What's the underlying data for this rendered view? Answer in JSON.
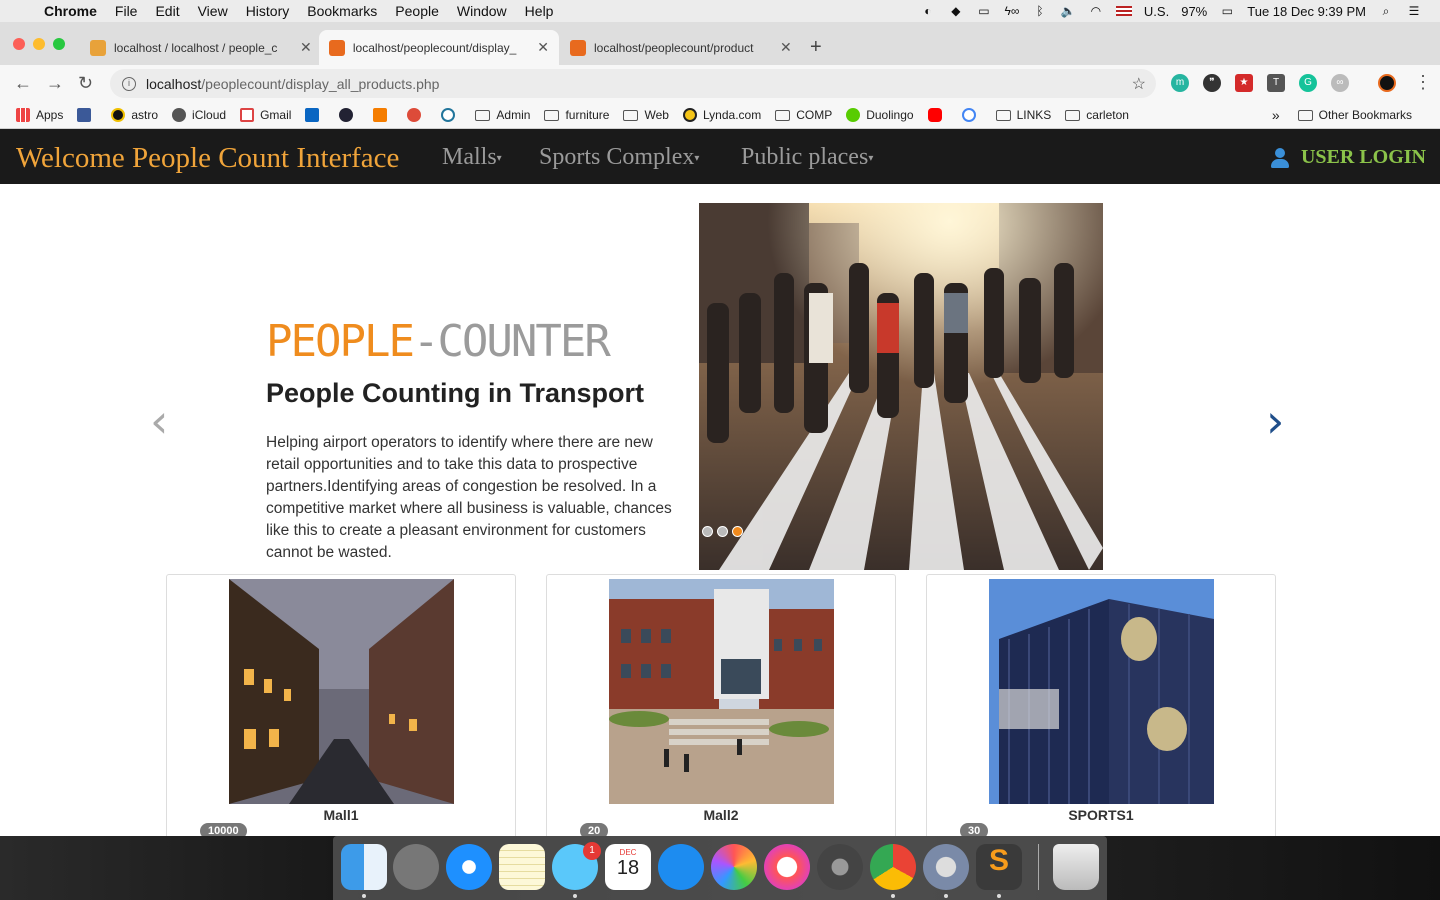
{
  "menubar": {
    "app": "Chrome",
    "items": [
      "File",
      "Edit",
      "View",
      "History",
      "Bookmarks",
      "People",
      "Window",
      "Help"
    ],
    "input_source": "U.S.",
    "battery": "97%",
    "datetime": "Tue 18 Dec  9:39 PM"
  },
  "tabs": [
    {
      "label": "localhost / localhost / people_c",
      "favicon_color": "#e8a23a"
    },
    {
      "label": "localhost/peoplecount/display_",
      "favicon_color": "#e86a1e"
    },
    {
      "label": "localhost/peoplecount/product",
      "favicon_color": "#e86a1e"
    }
  ],
  "address": {
    "host": "localhost",
    "path": "/peoplecount/display_all_products.php"
  },
  "bookmarks": {
    "items": [
      "Apps",
      "",
      "astro",
      "iCloud",
      "Gmail",
      "",
      "",
      "",
      "",
      "",
      "Admin",
      "furniture",
      "Web",
      "Lynda.com",
      "COMP",
      "Duolingo",
      "",
      "",
      "LINKS",
      "carleton"
    ],
    "overflow": "»",
    "other": "Other Bookmarks"
  },
  "navbar": {
    "brand": "Welcome People Count Interface",
    "links": [
      "Malls",
      "Sports Complex",
      "Public places"
    ],
    "login": "USER LOGIN"
  },
  "hero": {
    "title_part1": "PEOPLE",
    "title_part2": "-COUNTER",
    "subtitle": "People Counting in Transport",
    "text": "Helping airport operators to identify where there are new retail opportunities and to take this data to prospective partners.Identifying areas of congestion be resolved. In a competitive market where all business is valuable, chances like this to create a pleasant environment for customers cannot be wasted.",
    "slides": 3,
    "active_slide": 3
  },
  "cards": [
    {
      "name": "Mall1",
      "badge": "10000"
    },
    {
      "name": "Mall2",
      "badge": "20"
    },
    {
      "name": "SPORTS1",
      "badge": "30"
    }
  ],
  "dock": {
    "items": [
      "finder-icon",
      "launchpad-icon",
      "safari-icon",
      "notes-icon",
      "messages-icon",
      "calendar-icon",
      "app-store-icon",
      "photos-icon",
      "itunes-icon",
      "system-preferences-icon",
      "chrome-icon",
      "utility-icon",
      "sublime-text-icon",
      "trash-icon"
    ],
    "messages_badge": "1",
    "calendar_month": "DEC",
    "calendar_day": "18"
  }
}
